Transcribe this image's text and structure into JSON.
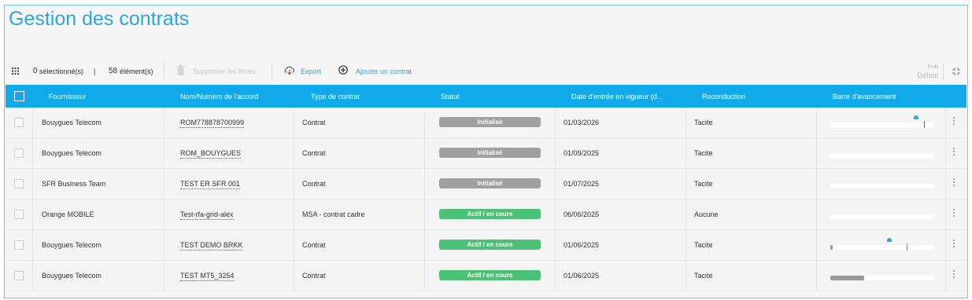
{
  "page": {
    "title": "Gestion des contrats"
  },
  "toolbar": {
    "selected_count": "0",
    "selected_label": "sélectionné(s)",
    "separator": "|",
    "element_count": "58",
    "element_label": "élément(s)",
    "clear_filters_label": "Supprimer les filtres",
    "export_label": "Export",
    "add_contract_label": "Ajouter un contrat",
    "profile_label": "Profil",
    "profile_value": "Défaut"
  },
  "table": {
    "columns": [
      "Fournisseur",
      "Nom/Numéro de l'accord",
      "Type de contrat",
      "Statut",
      "Date d'entrée en vigueur (d...",
      "Reconduction",
      "Barre d'avancement"
    ],
    "rows": [
      {
        "fournisseur": "Bouygues Telecom",
        "accord": "ROM778878700999",
        "type": "Contrat",
        "statut": "Initialisé",
        "statut_kind": "init",
        "date": "01/03/2026",
        "reconduction": "Tacite",
        "progress": 0.0,
        "has_bell": true
      },
      {
        "fournisseur": "Bouygues Telecom",
        "accord": "ROM_BOUYGUES",
        "type": "Contrat",
        "statut": "Initialisé",
        "statut_kind": "init",
        "date": "01/09/2025",
        "reconduction": "Tacite",
        "progress": 0.0,
        "has_bell": false
      },
      {
        "fournisseur": "SFR Business Team",
        "accord": "TEST ER SFR 001",
        "type": "Contrat",
        "statut": "Initialisé",
        "statut_kind": "init",
        "date": "01/07/2025",
        "reconduction": "Tacite",
        "progress": 0.0,
        "has_bell": false
      },
      {
        "fournisseur": "Orange MOBILE",
        "accord": "Test-rfa-grid-alex",
        "type": "MSA - contrat cadre",
        "statut": "Actif / en cours",
        "statut_kind": "actif",
        "date": "06/06/2025",
        "reconduction": "Aucune",
        "progress": 0.0,
        "has_bell": false
      },
      {
        "fournisseur": "Bouygues Telecom",
        "accord": "TEST DEMO BRKK",
        "type": "Contrat",
        "statut": "Actif / en cours",
        "statut_kind": "actif",
        "date": "01/06/2025",
        "reconduction": "Tacite",
        "progress": 0.02,
        "has_bell": true
      },
      {
        "fournisseur": "Bouygues Telecom",
        "accord": "TEST MT5_3254",
        "type": "Contrat",
        "statut": "Actif / en cours",
        "statut_kind": "actif",
        "date": "01/06/2025",
        "reconduction": "Tacite",
        "progress": 0.33,
        "has_bell": false
      }
    ]
  },
  "colors": {
    "accent": "#29a8dc",
    "header_bg": "#12a9ea",
    "status_init": "#a0a0a0",
    "status_actif": "#4cc074"
  },
  "icons": [
    "grid-icon",
    "trash-icon",
    "cloud-download-icon",
    "plus-circle-icon",
    "expand-icon",
    "bell-icon",
    "more-vertical-icon"
  ]
}
